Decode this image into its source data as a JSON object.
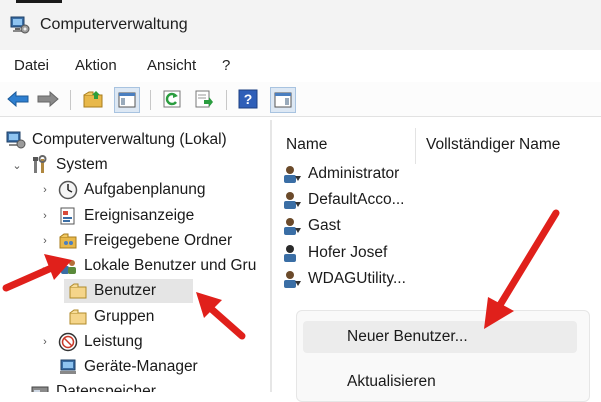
{
  "window": {
    "title": "Computerverwaltung"
  },
  "menu": [
    "Datei",
    "Aktion",
    "Ansicht",
    "?"
  ],
  "toolbar": {
    "icons": [
      "back-arrow-icon",
      "forward-arrow-icon",
      "up-folder-icon",
      "show-hide-console-tree-icon",
      "refresh-icon",
      "export-list-icon",
      "help-icon",
      "show-action-pane-icon"
    ]
  },
  "tree": {
    "root": "Computerverwaltung (Lokal)",
    "system": "System",
    "aufgaben": "Aufgabenplanung",
    "ereignis": "Ereignisanzeige",
    "freigabe": "Freigegebene Ordner",
    "lokal": "Lokale Benutzer und Gru",
    "benutzer": "Benutzer",
    "gruppen": "Gruppen",
    "leistung": "Leistung",
    "geraete": "Geräte-Manager",
    "datenspeicher": "Datenspeicher"
  },
  "list": {
    "columns": [
      "Name",
      "Vollständiger Name"
    ],
    "rows": [
      "Administrator",
      "DefaultAcco...",
      "Gast",
      "Hofer Josef",
      "WDAGUtility..."
    ]
  },
  "context_menu": {
    "items": [
      "Neuer Benutzer...",
      "Aktualisieren"
    ],
    "hovered": "Neuer Benutzer..."
  },
  "colors": {
    "annotation_arrow": "#e0201b",
    "selection": "#e5e5e5"
  }
}
